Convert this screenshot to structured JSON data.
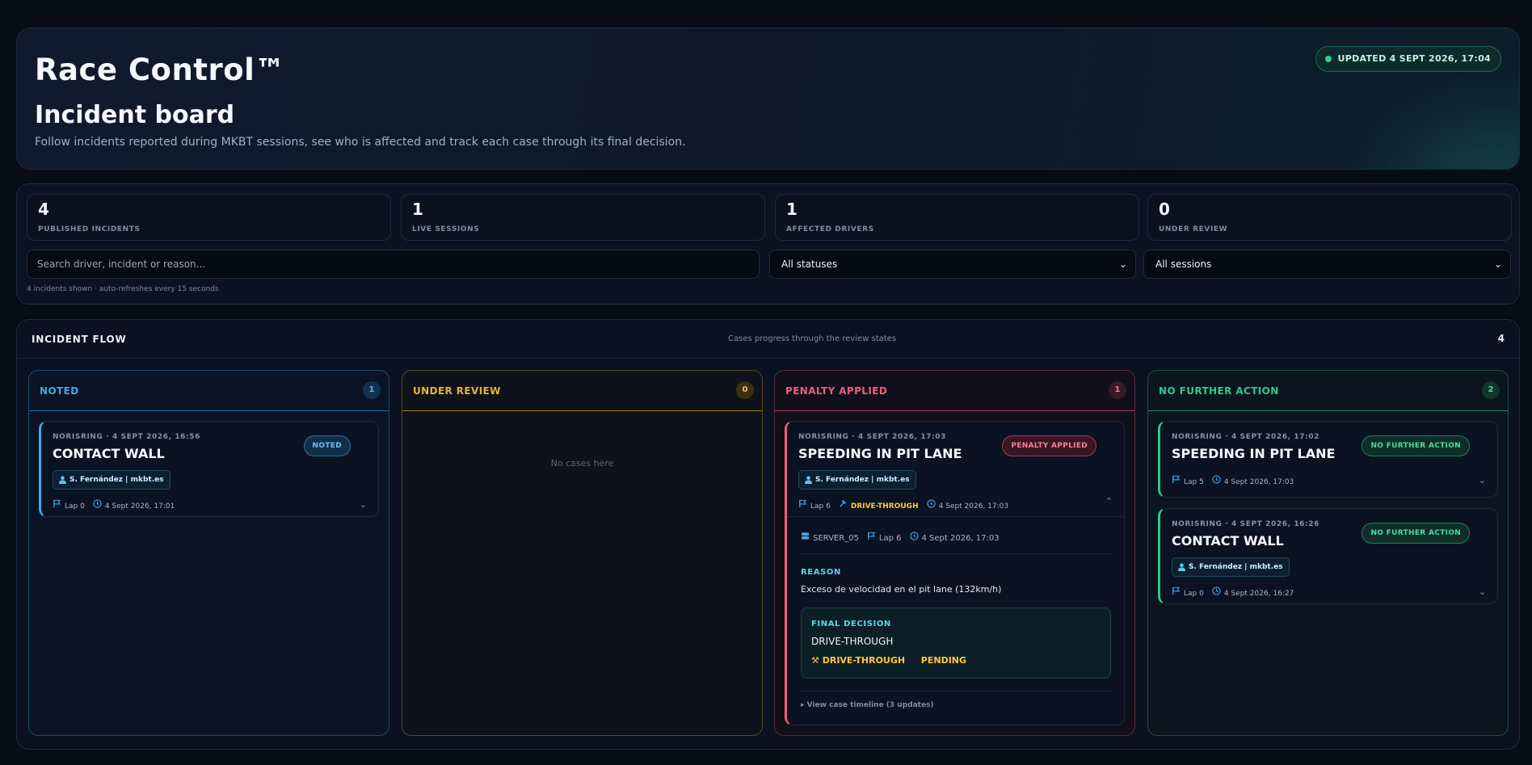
{
  "header": {
    "brand": "Race Control™",
    "title": "Incident board",
    "subtitle": "Follow incidents reported during MKBT sessions, see who is affected and track each case through its final decision.",
    "updated": "UPDATED 4 SEPT 2026, 17:04"
  },
  "stats": [
    {
      "value": "4",
      "label": "PUBLISHED INCIDENTS"
    },
    {
      "value": "1",
      "label": "LIVE SESSIONS"
    },
    {
      "value": "1",
      "label": "AFFECTED DRIVERS"
    },
    {
      "value": "0",
      "label": "UNDER REVIEW"
    }
  ],
  "filters": {
    "search_placeholder": "Search driver, incident or reason...",
    "status_value": "All statuses",
    "session_value": "All sessions",
    "footnote": "4 incidents shown · auto-refreshes every 15 seconds"
  },
  "flow": {
    "title": "INCIDENT FLOW",
    "subtitle": "Cases progress through the review states",
    "count": "4",
    "columns": [
      {
        "title": "NOTED",
        "count": "1",
        "accent": "#3fa9e8"
      },
      {
        "title": "UNDER REVIEW",
        "count": "0",
        "accent": "#e6b43a",
        "empty": "No cases here"
      },
      {
        "title": "PENALTY APPLIED",
        "count": "1",
        "accent": "#ec5f7a"
      },
      {
        "title": "NO FURTHER ACTION",
        "count": "2",
        "accent": "#2fc98c"
      }
    ]
  },
  "cards": {
    "noted_1": {
      "meta": "NORISRING · 4 SEPT 2026, 16:56",
      "title": "CONTACT WALL",
      "badge": "NOTED",
      "driver": "S. Fernández | mkbt.es",
      "lap": "Lap 0",
      "time": "4 Sept 2026, 17:01"
    },
    "penalty_1": {
      "meta": "NORISRING · 4 SEPT 2026, 17:03",
      "title": "SPEEDING IN PIT LANE",
      "badge": "PENALTY APPLIED",
      "driver": "S. Fernández | mkbt.es",
      "lap": "Lap 6",
      "penalty": "DRIVE-THROUGH",
      "time": "4 Sept 2026, 17:03",
      "server": "SERVER_05",
      "detail_lap": "Lap 6",
      "detail_time": "4 Sept 2026, 17:03",
      "reason_label": "REASON",
      "reason": "Exceso de velocidad en el pit lane (132km/h)",
      "decision_label": "FINAL DECISION",
      "decision": "DRIVE-THROUGH",
      "decision_penalty": "DRIVE-THROUGH",
      "decision_state": "PENDING",
      "timeline": "View case timeline (3 updates)"
    },
    "nfa_1": {
      "meta": "NORISRING · 4 SEPT 2026, 17:02",
      "title": "SPEEDING IN PIT LANE",
      "badge": "NO FURTHER ACTION",
      "lap": "Lap 5",
      "time": "4 Sept 2026, 17:03"
    },
    "nfa_2": {
      "meta": "NORISRING · 4 SEPT 2026, 16:26",
      "title": "CONTACT WALL",
      "badge": "NO FURTHER ACTION",
      "driver": "S. Fernández | mkbt.es",
      "lap": "Lap 0",
      "time": "4 Sept 2026, 16:27"
    }
  },
  "icons": {
    "flag": "flag-icon",
    "clock": "clock-icon",
    "user": "user-icon",
    "hammer": "hammer-icon",
    "server": "server-icon",
    "chevron": "chevron-icon"
  }
}
